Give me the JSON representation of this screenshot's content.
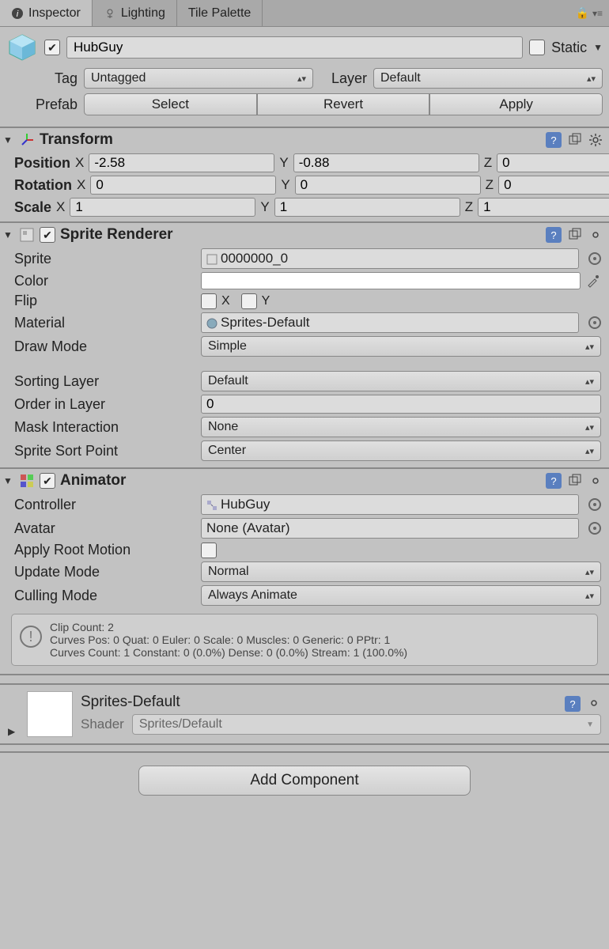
{
  "tabs": {
    "inspector": "Inspector",
    "lighting": "Lighting",
    "tile_palette": "Tile Palette"
  },
  "header": {
    "name": "HubGuy",
    "static_label": "Static",
    "tag_label": "Tag",
    "tag_value": "Untagged",
    "layer_label": "Layer",
    "layer_value": "Default",
    "prefab_label": "Prefab",
    "select_btn": "Select",
    "revert_btn": "Revert",
    "apply_btn": "Apply"
  },
  "transform": {
    "title": "Transform",
    "position_label": "Position",
    "pos": {
      "x": "-2.58",
      "y": "-0.88",
      "z": "0"
    },
    "rotation_label": "Rotation",
    "rot": {
      "x": "0",
      "y": "0",
      "z": "0"
    },
    "scale_label": "Scale",
    "scl": {
      "x": "1",
      "y": "1",
      "z": "1"
    },
    "xl": "X",
    "yl": "Y",
    "zl": "Z"
  },
  "sprite_renderer": {
    "title": "Sprite Renderer",
    "sprite_label": "Sprite",
    "sprite_value": "0000000_0",
    "color_label": "Color",
    "flip_label": "Flip",
    "flip_x": "X",
    "flip_y": "Y",
    "material_label": "Material",
    "material_value": "Sprites-Default",
    "draw_mode_label": "Draw Mode",
    "draw_mode_value": "Simple",
    "sorting_layer_label": "Sorting Layer",
    "sorting_layer_value": "Default",
    "order_label": "Order in Layer",
    "order_value": "0",
    "mask_label": "Mask Interaction",
    "mask_value": "None",
    "sort_point_label": "Sprite Sort Point",
    "sort_point_value": "Center"
  },
  "animator": {
    "title": "Animator",
    "controller_label": "Controller",
    "controller_value": "HubGuy",
    "avatar_label": "Avatar",
    "avatar_value": "None (Avatar)",
    "root_motion_label": "Apply Root Motion",
    "update_mode_label": "Update Mode",
    "update_mode_value": "Normal",
    "culling_mode_label": "Culling Mode",
    "culling_mode_value": "Always Animate",
    "info_line1": "Clip Count: 2",
    "info_line2": "Curves Pos: 0 Quat: 0 Euler: 0 Scale: 0 Muscles: 0 Generic: 0 PPtr: 1",
    "info_line3": "Curves Count: 1 Constant: 0 (0.0%) Dense: 0 (0.0%) Stream: 1 (100.0%)"
  },
  "material": {
    "title": "Sprites-Default",
    "shader_label": "Shader",
    "shader_value": "Sprites/Default"
  },
  "footer": {
    "add_component": "Add Component"
  }
}
